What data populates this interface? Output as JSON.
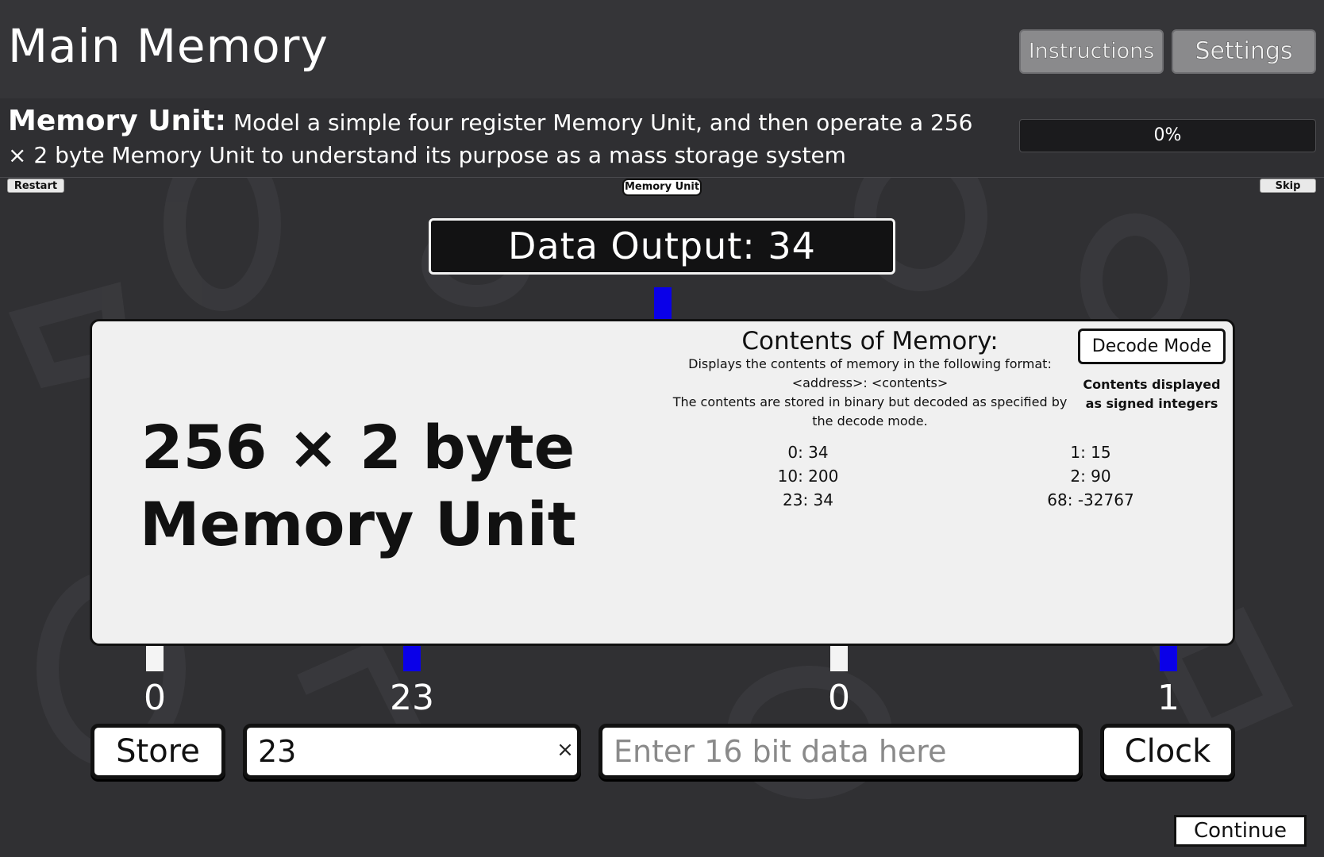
{
  "header": {
    "title": "Main Memory",
    "instructions_label": "Instructions",
    "settings_label": "Settings"
  },
  "description": {
    "title": "Memory Unit:",
    "text": " Model a simple four register Memory Unit, and then operate a 256 × 2 byte Memory Unit to understand its purpose as a mass storage system"
  },
  "progress": {
    "value": 0,
    "label": "0%"
  },
  "toolbar": {
    "restart_label": "Restart",
    "skip_label": "Skip",
    "scene_tag": "Memory Unit"
  },
  "output": {
    "label": "Data Output: 34"
  },
  "memory": {
    "title": "256 × 2 byte Memory Unit",
    "contents_heading": "Contents of Memory:",
    "contents_desc_1": "Displays the contents of memory in the following format:",
    "contents_desc_2": "<address>: <contents>",
    "contents_desc_3": "The contents are stored in binary but decoded as specified by the decode mode.",
    "decode_button": "Decode Mode",
    "decode_note": "Contents displayed as signed integers",
    "entries_left": [
      "0: 34",
      "10: 200",
      "23: 34"
    ],
    "entries_right": [
      "1: 15",
      "2: 90",
      "68: -32767"
    ]
  },
  "signals": {
    "output_wire": true,
    "store": {
      "value": "0",
      "active": false
    },
    "address": {
      "value": "23",
      "active": true
    },
    "data": {
      "value": "0",
      "active": false
    },
    "clock": {
      "value": "1",
      "active": true
    }
  },
  "controls": {
    "store_label": "Store",
    "address_value": "23",
    "clear_symbol": "×",
    "data_value": "",
    "data_placeholder": "Enter 16 bit data here",
    "clock_label": "Clock"
  },
  "footer": {
    "continue_label": "Continue"
  },
  "colors": {
    "wire_on": "#0a00e8",
    "wire_off": "#f4f4f4",
    "background": "#303033",
    "panel": "#f0f0f0"
  }
}
